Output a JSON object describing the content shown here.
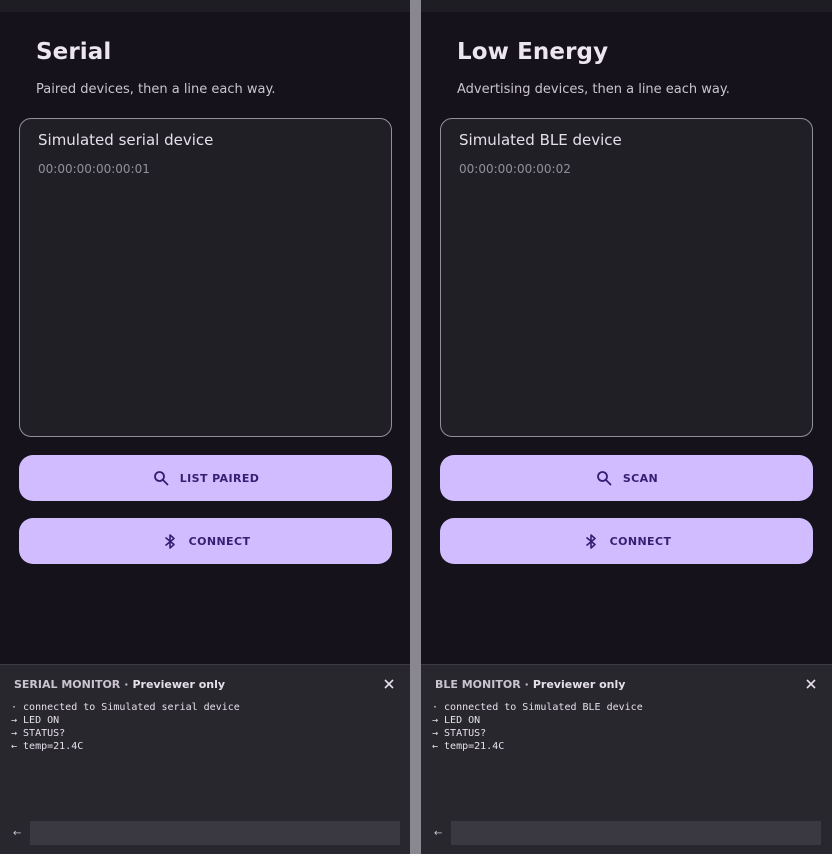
{
  "serial": {
    "title": "Serial",
    "subtitle": "Paired devices, then a line each way.",
    "device": {
      "name": "Simulated serial device",
      "address": "00:00:00:00:00:01"
    },
    "primary_button": "LIST PAIRED",
    "connect_button": "CONNECT",
    "monitor": {
      "name": "SERIAL MONITOR",
      "separator": "·",
      "mode": "Previewer only",
      "log": [
        "· connected to Simulated serial device",
        "→ LED ON",
        "→ STATUS?",
        "← temp=21.4C"
      ],
      "send_icon": "←",
      "input_value": "",
      "input_placeholder": ""
    }
  },
  "ble": {
    "title": "Low Energy",
    "subtitle": "Advertising devices, then a line each way.",
    "device": {
      "name": "Simulated BLE device",
      "address": "00:00:00:00:00:02"
    },
    "primary_button": "SCAN",
    "connect_button": "CONNECT",
    "monitor": {
      "name": "BLE MONITOR",
      "separator": "·",
      "mode": "Previewer only",
      "log": [
        "· connected to Simulated BLE device",
        "→ LED ON",
        "→ STATUS?",
        "← temp=21.4C"
      ],
      "send_icon": "←",
      "input_value": "",
      "input_placeholder": ""
    }
  },
  "icons": {
    "search": "search-icon",
    "bluetooth": "bluetooth-icon",
    "close": "close-icon"
  },
  "colors": {
    "background": "#15121b",
    "surface": "#211f26",
    "outline": "#938f99",
    "primary": "#d0bcff",
    "on_primary": "#381e72",
    "monitor_bg": "#29272e"
  }
}
